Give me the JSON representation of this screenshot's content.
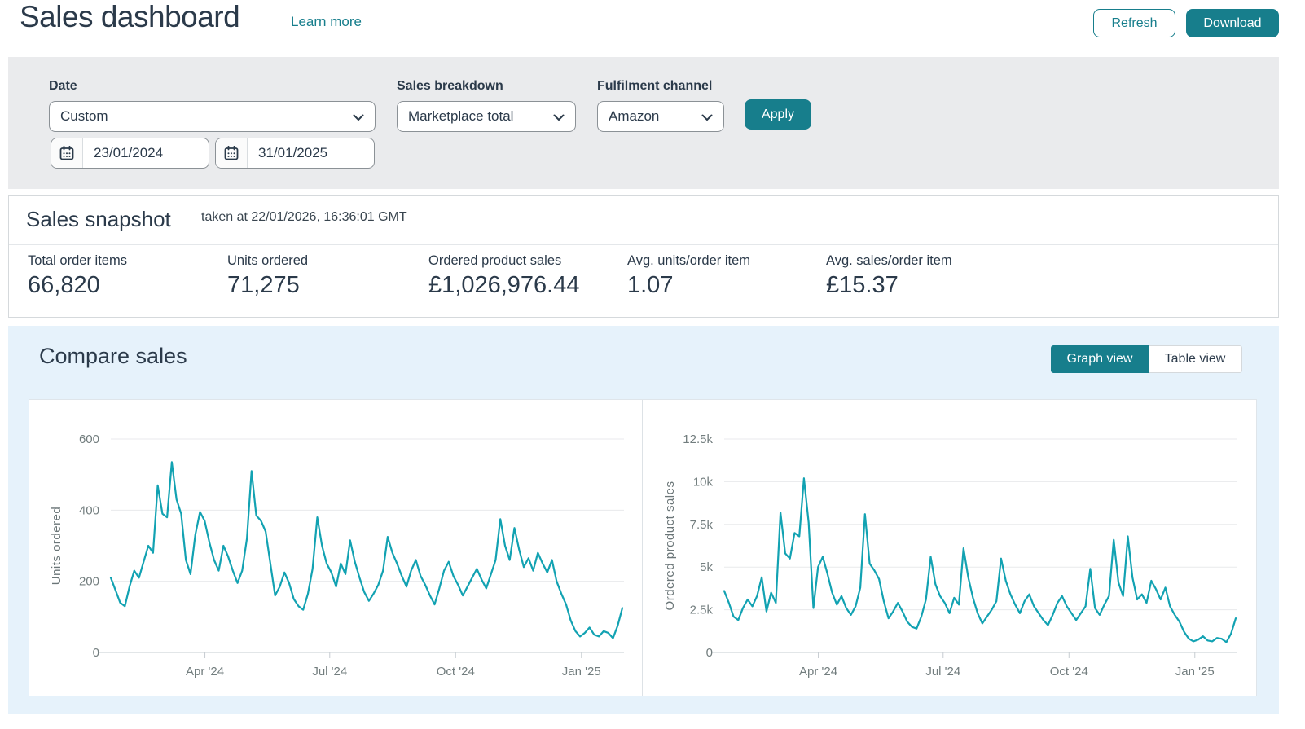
{
  "page": {
    "title": "Sales dashboard",
    "learn_more": "Learn more"
  },
  "header": {
    "refresh_label": "Refresh",
    "download_label": "Download"
  },
  "filters": {
    "date": {
      "label": "Date",
      "selected": "Custom",
      "from": "23/01/2024",
      "to": "31/01/2025"
    },
    "sales_breakdown": {
      "label": "Sales breakdown",
      "selected": "Marketplace total"
    },
    "fulfilment_channel": {
      "label": "Fulfilment channel",
      "selected": "Amazon"
    },
    "apply_label": "Apply"
  },
  "snapshot": {
    "title": "Sales snapshot",
    "taken_at": "taken at 22/01/2026, 16:36:01 GMT",
    "metrics": [
      {
        "label": "Total order items",
        "value": "66,820"
      },
      {
        "label": "Units ordered",
        "value": "71,275"
      },
      {
        "label": "Ordered product sales",
        "value": "£1,026,976.44"
      },
      {
        "label": "Avg. units/order item",
        "value": "1.07"
      },
      {
        "label": "Avg. sales/order item",
        "value": "£15.37"
      }
    ]
  },
  "compare": {
    "title": "Compare sales",
    "graph_view_label": "Graph view",
    "table_view_label": "Table view"
  },
  "colors": {
    "accent_teal": "#177e8c",
    "line_teal": "#12a2b2",
    "panel_blue": "#e6f2fb",
    "filter_gray": "#eaebed",
    "grid": "#e8eaec",
    "axis": "#c6ccd1",
    "tick_text": "#727d7e"
  },
  "chart_data": [
    {
      "type": "line",
      "title": "Units ordered over time",
      "ylabel": "Units ordered",
      "x_range": [
        "23/01/2024",
        "31/01/2025"
      ],
      "grid": true,
      "legend": "none",
      "y_axis_max": 600,
      "y_ticks": [
        {
          "value": 0,
          "label": "0"
        },
        {
          "value": 200,
          "label": "200"
        },
        {
          "value": 400,
          "label": "400"
        },
        {
          "value": 600,
          "label": "600"
        }
      ],
      "x_ticks": [
        {
          "frac": 0.184,
          "label": "Apr '24"
        },
        {
          "frac": 0.428,
          "label": "Jul '24"
        },
        {
          "frac": 0.674,
          "label": "Oct '24"
        },
        {
          "frac": 0.92,
          "label": "Jan '25"
        }
      ],
      "values": [
        210,
        175,
        140,
        130,
        185,
        230,
        210,
        255,
        300,
        280,
        470,
        390,
        380,
        535,
        430,
        390,
        260,
        220,
        330,
        395,
        370,
        310,
        260,
        230,
        300,
        270,
        230,
        195,
        230,
        320,
        510,
        385,
        370,
        340,
        250,
        160,
        185,
        225,
        195,
        150,
        130,
        120,
        165,
        235,
        380,
        300,
        250,
        225,
        185,
        250,
        220,
        315,
        255,
        210,
        170,
        145,
        165,
        190,
        230,
        325,
        280,
        250,
        215,
        185,
        230,
        260,
        215,
        190,
        160,
        135,
        180,
        230,
        255,
        215,
        190,
        160,
        185,
        210,
        235,
        205,
        180,
        220,
        260,
        375,
        300,
        260,
        350,
        290,
        240,
        265,
        230,
        280,
        250,
        225,
        260,
        200,
        165,
        135,
        90,
        60,
        45,
        55,
        70,
        50,
        45,
        60,
        55,
        40,
        75,
        125
      ]
    },
    {
      "type": "line",
      "title": "Ordered product sales over time",
      "ylabel": "Ordered product sales",
      "x_range": [
        "23/01/2024",
        "31/01/2025"
      ],
      "grid": true,
      "legend": "none",
      "y_axis_max": 12500,
      "y_ticks": [
        {
          "value": 0,
          "label": "0"
        },
        {
          "value": 2500,
          "label": "2.5k"
        },
        {
          "value": 5000,
          "label": "5k"
        },
        {
          "value": 7500,
          "label": "7.5k"
        },
        {
          "value": 10000,
          "label": "10k"
        },
        {
          "value": 12500,
          "label": "12.5k"
        }
      ],
      "x_ticks": [
        {
          "frac": 0.184,
          "label": "Apr '24"
        },
        {
          "frac": 0.428,
          "label": "Jul '24"
        },
        {
          "frac": 0.674,
          "label": "Oct '24"
        },
        {
          "frac": 0.92,
          "label": "Jan '25"
        }
      ],
      "values": [
        3600,
        2900,
        2100,
        1900,
        2600,
        3100,
        2700,
        3300,
        4400,
        2400,
        3500,
        2900,
        8200,
        5800,
        5500,
        7000,
        6800,
        10200,
        7600,
        2600,
        5000,
        5600,
        4600,
        3500,
        2800,
        3300,
        2600,
        2200,
        2700,
        3800,
        8100,
        5200,
        4800,
        4300,
        3000,
        2000,
        2400,
        2900,
        2400,
        1800,
        1500,
        1400,
        2100,
        3100,
        5600,
        4000,
        3300,
        2900,
        2300,
        3200,
        2800,
        6100,
        4400,
        3200,
        2300,
        1700,
        2100,
        2500,
        3000,
        5500,
        4200,
        3400,
        2800,
        2300,
        3000,
        3400,
        2700,
        2300,
        1900,
        1600,
        2200,
        2900,
        3300,
        2700,
        2300,
        1900,
        2300,
        2700,
        4900,
        2600,
        2200,
        2800,
        3300,
        6600,
        4100,
        3300,
        6800,
        4400,
        3100,
        3400,
        2900,
        4200,
        3700,
        3100,
        3800,
        2700,
        2200,
        1800,
        1200,
        800,
        650,
        750,
        950,
        700,
        650,
        850,
        800,
        600,
        1100,
        2000
      ]
    }
  ]
}
